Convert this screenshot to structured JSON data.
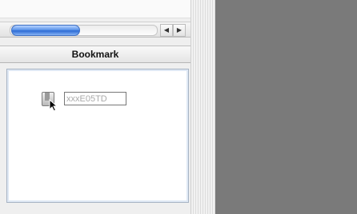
{
  "panel": {
    "header_title": "Bookmark"
  },
  "scrollbar": {
    "left_arrow": "◀",
    "right_arrow": "▶",
    "position": 0.0
  },
  "bookmarks": [
    {
      "name": "xxxE05TD",
      "icon": "bookmark-icon"
    }
  ],
  "colors": {
    "scroll_thumb": "#3a7be0",
    "desktop_background": "#7a7a7a"
  }
}
